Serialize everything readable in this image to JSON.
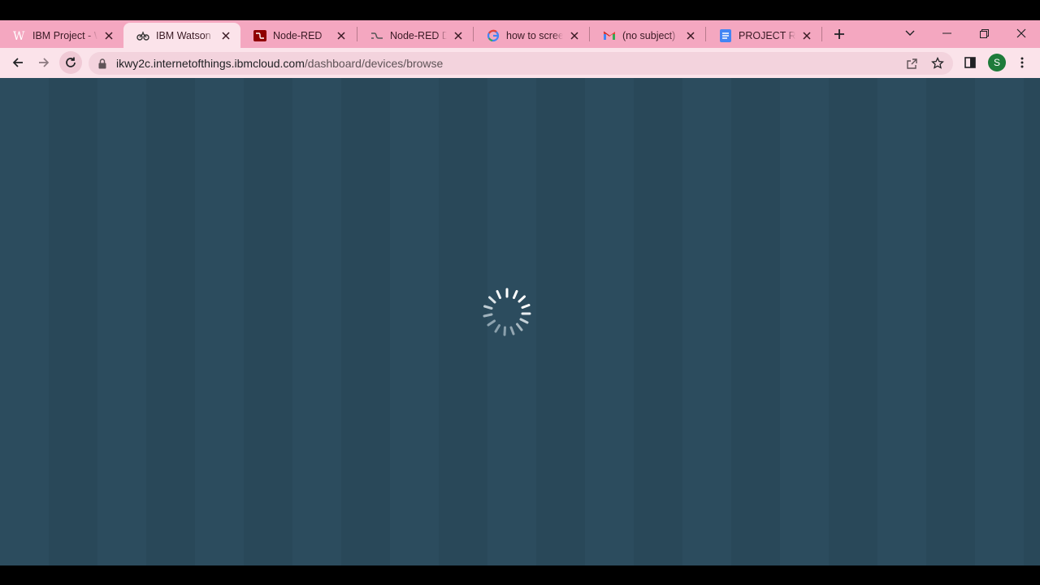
{
  "browser": {
    "tabs": [
      {
        "title": "IBM Project - W",
        "favicon": "wikipedia-icon",
        "active": false
      },
      {
        "title": "IBM Watson Io",
        "favicon": "iot-icon",
        "active": true
      },
      {
        "title": "Node-RED",
        "favicon": "node-red-icon",
        "active": false
      },
      {
        "title": "Node-RED Das",
        "favicon": "node-red-dashboard-icon",
        "active": false
      },
      {
        "title": "how to screen",
        "favicon": "google-icon",
        "active": false
      },
      {
        "title": "(no subject) - s",
        "favicon": "gmail-icon",
        "active": false
      },
      {
        "title": "PROJECT REPO",
        "favicon": "docs-icon",
        "active": false
      }
    ],
    "url_host": "ikwy2c.internetofthings.ibmcloud.com",
    "url_path": "/dashboard/devices/browse",
    "profile_initial": "S",
    "colors": {
      "tabstrip": "#f4a7c0",
      "active_tab": "#fbe3ea",
      "page_background": "#2a4a5c",
      "avatar": "#1e7b3a"
    }
  },
  "page": {
    "state": "loading",
    "spinner": "loading-spinner-icon"
  }
}
